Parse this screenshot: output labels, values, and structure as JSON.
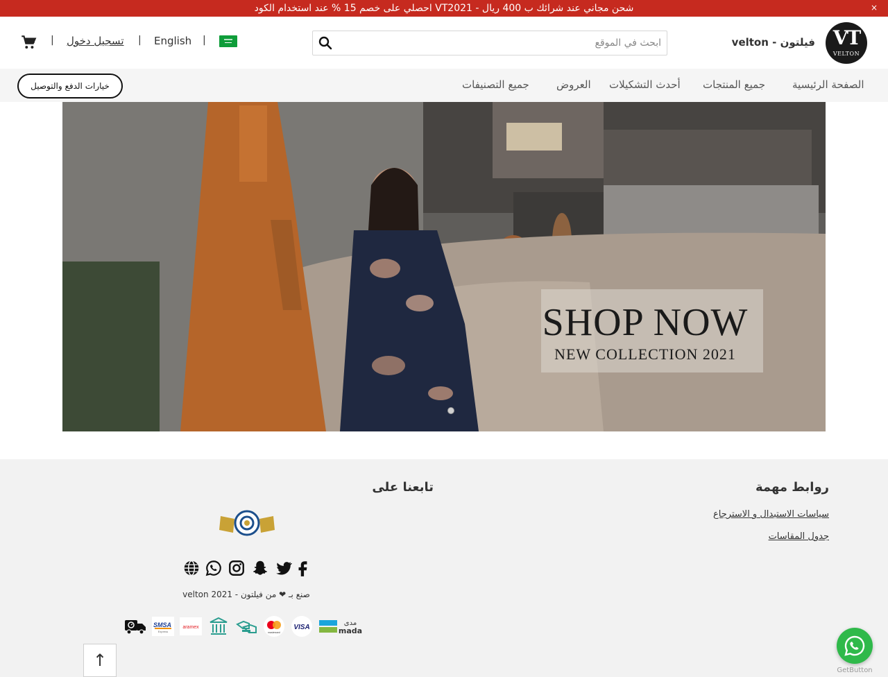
{
  "announcement": {
    "text": "احصلي على خصم 15 % عند استخدام الكود VT2021 - شحن مجاني عند شرائك ب 400 ريال",
    "close": "×"
  },
  "header": {
    "logo_monogram": "VT",
    "logo_word": "VELTON",
    "store_name": "فيلتون - velton",
    "search_placeholder": "ابحث في الموقع",
    "search_value": "",
    "separator": "|",
    "language_label": "English",
    "login_label": "تسجيل دخول"
  },
  "nav": {
    "items": [
      "الصفحة الرئيسية",
      "جميع المنتجات",
      "أحدث التشكيلات",
      "العروض",
      "جميع التصنيفات"
    ],
    "payment_button": "خيارات الدفع والتوصيل"
  },
  "hero": {
    "title": "SHOP NOW",
    "subtitle": "NEW COLLECTION 2021",
    "active_slide": 1,
    "slide_count": 1
  },
  "footer": {
    "links_title": "روابط مهمة",
    "links": [
      "سياسات الاستبدال و الاسترجاع",
      "جدول المقاسات"
    ],
    "follow_title": "تابعنا على",
    "social_icons": [
      "facebook-icon",
      "twitter-icon",
      "snapchat-icon",
      "instagram-icon",
      "whatsapp-icon",
      "globe-icon"
    ],
    "credit": "صنع بـ ❤ من فيلتون - velton 2021",
    "payment_labels": {
      "mada": "mada",
      "mada_ar": "مدى",
      "visa": "VISA",
      "mastercard": "mastercard",
      "aramex": "aramex",
      "smsa": "SMSA",
      "smsa_sub": "Express"
    },
    "scroll_top": "↑"
  },
  "floating": {
    "getbutton": "GetButton"
  },
  "colors": {
    "announcement_bg": "#c62a1f",
    "nav_bg": "#f5f5f5",
    "footer_bg": "#f2f2f2",
    "whatsapp": "#2fb94a",
    "accent_dark": "#111111"
  }
}
